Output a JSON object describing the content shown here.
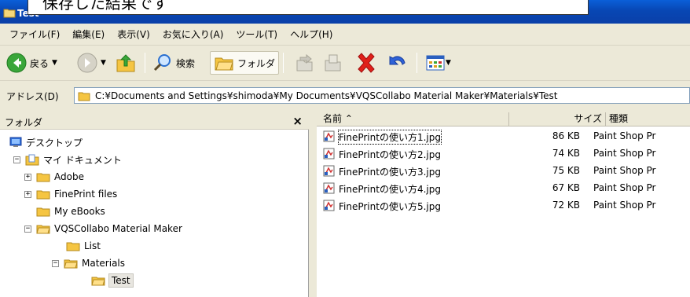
{
  "window": {
    "title": "Test"
  },
  "callout": "保存した結果です",
  "menu": [
    "ファイル(F)",
    "編集(E)",
    "表示(V)",
    "お気に入り(A)",
    "ツール(T)",
    "ヘルプ(H)"
  ],
  "toolbar": {
    "back_label": "戻る",
    "search_label": "検索",
    "folders_label": "フォルダ"
  },
  "address": {
    "label": "アドレス(D)",
    "path": "C:¥Documents and Settings¥shimoda¥My Documents¥VQSCollabo Material Maker¥Materials¥Test"
  },
  "folder_pane": {
    "title": "フォルダ",
    "close": "×",
    "items": [
      {
        "label": "デスクトップ",
        "expander": ""
      },
      {
        "label": "マイ ドキュメント",
        "expander": "−"
      },
      {
        "label": "Adobe",
        "expander": "+"
      },
      {
        "label": "FinePrint files",
        "expander": "+"
      },
      {
        "label": "My eBooks",
        "expander": ""
      },
      {
        "label": "VQSCollabo Material Maker",
        "expander": "−"
      },
      {
        "label": "List",
        "expander": ""
      },
      {
        "label": "Materials",
        "expander": "−"
      },
      {
        "label": "Test",
        "expander": ""
      }
    ]
  },
  "file_list": {
    "columns": {
      "name": "名前 ⌃",
      "size": "サイズ",
      "type": "種類"
    },
    "rows": [
      {
        "name": "FinePrintの使い方1.jpg",
        "size": "86 KB",
        "type": "Paint Shop Pr"
      },
      {
        "name": "FinePrintの使い方2.jpg",
        "size": "74 KB",
        "type": "Paint Shop Pr"
      },
      {
        "name": "FinePrintの使い方3.jpg",
        "size": "75 KB",
        "type": "Paint Shop Pr"
      },
      {
        "name": "FinePrintの使い方4.jpg",
        "size": "67 KB",
        "type": "Paint Shop Pr"
      },
      {
        "name": "FinePrintの使い方5.jpg",
        "size": "72 KB",
        "type": "Paint Shop Pr"
      }
    ]
  }
}
